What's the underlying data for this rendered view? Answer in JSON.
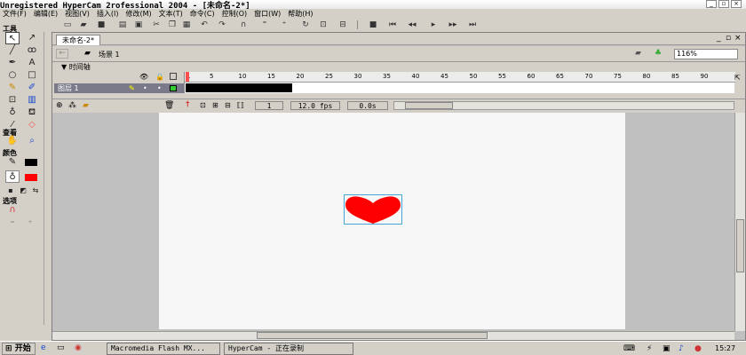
{
  "window": {
    "title": "Unregistered HyperCam 2rofessional 2004 - [未命名-2*]",
    "min": "_",
    "restore": "▫",
    "close": "×"
  },
  "menu": [
    "文件(F)",
    "编辑(E)",
    "视图(V)",
    "插入(I)",
    "修改(M)",
    "文本(T)",
    "命令(C)",
    "控制(O)",
    "窗口(W)",
    "帮助(H)"
  ],
  "tools": {
    "header": "工具",
    "view_header": "查看",
    "colors_header": "颜色",
    "options_header": "选项"
  },
  "document": {
    "tab": "未命名-2*",
    "scene": "场景 1",
    "zoom": "116%"
  },
  "timeline": {
    "title": "时间轴",
    "layer_name": "图层 1",
    "frame_numbers": [
      "1",
      "5",
      "10",
      "15",
      "20",
      "25",
      "30",
      "35",
      "40",
      "45",
      "50",
      "55",
      "60",
      "65",
      "70",
      "75",
      "80",
      "85",
      "90"
    ],
    "current_frame": "1",
    "fps": "12.0 fps",
    "time": "0.0s"
  },
  "colors": {
    "heart": "#ff0000",
    "selection": "#4aa3d8"
  },
  "taskbar": {
    "start": "开始",
    "tasks": [
      "Macromedia Flash MX...",
      "HyperCam - 正在录制"
    ],
    "clock": "15:27"
  }
}
